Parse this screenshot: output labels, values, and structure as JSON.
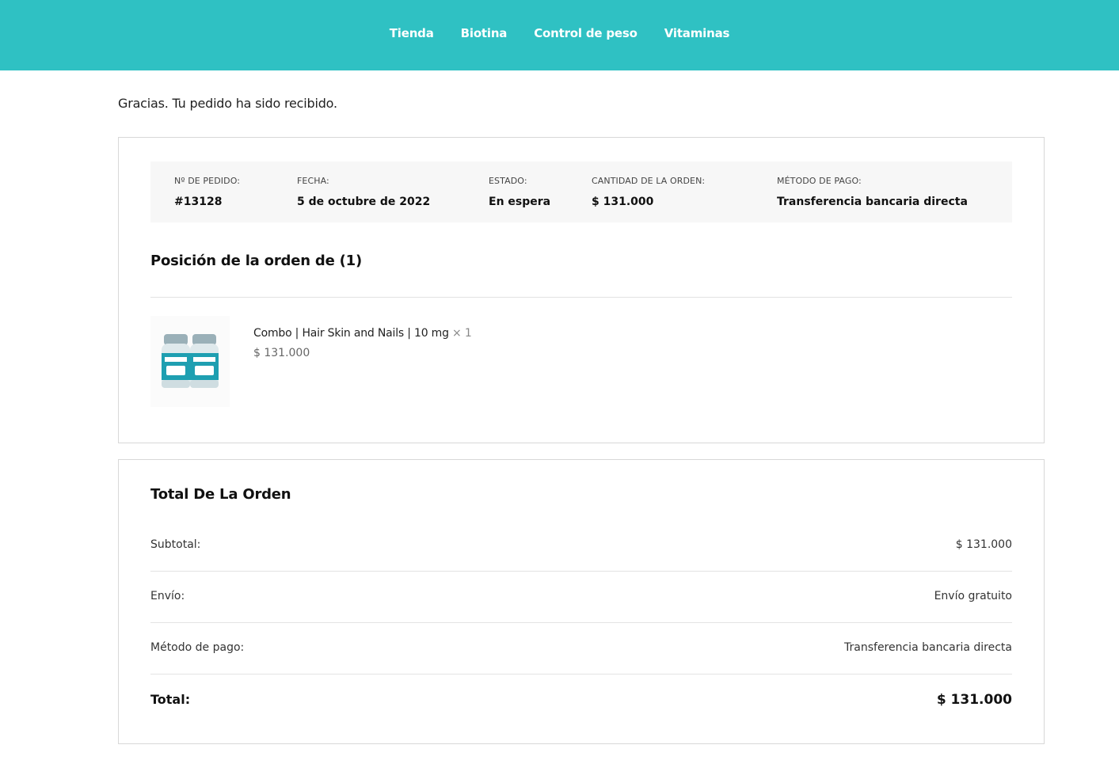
{
  "nav": {
    "items": [
      "Tienda",
      "Biotina",
      "Control de peso",
      "Vitaminas"
    ]
  },
  "thanks_message": "Gracias. Tu pedido ha sido recibido.",
  "overview": {
    "order_number": {
      "label": "Nº DE PEDIDO:",
      "value": "#13128"
    },
    "date": {
      "label": "FECHA:",
      "value": "5 de octubre de 2022"
    },
    "status": {
      "label": "ESTADO:",
      "value": "En espera"
    },
    "amount": {
      "label": "CANTIDAD DE LA ORDEN:",
      "value": "$ 131.000"
    },
    "payment": {
      "label": "MÉTODO DE PAGO:",
      "value": "Transferencia bancaria directa"
    }
  },
  "items_section": {
    "title": "Posición de la orden de (1)",
    "items": [
      {
        "name": "Combo | Hair Skin and Nails | 10 mg",
        "qty": "× 1",
        "price": "$ 131.000"
      }
    ]
  },
  "totals": {
    "title": "Total De La Orden",
    "subtotal": {
      "label": "Subtotal:",
      "value": "$ 131.000"
    },
    "shipping": {
      "label": "Envío:",
      "value": "Envío gratuito"
    },
    "payment_method": {
      "label": "Método de pago:",
      "value": "Transferencia bancaria directa"
    },
    "total": {
      "label": "Total:",
      "value": "$ 131.000"
    }
  },
  "colors": {
    "header": "#2fc1c3",
    "overview_bg": "#f7f7f7"
  },
  "product_image_icon": "biotin-bottles-image"
}
